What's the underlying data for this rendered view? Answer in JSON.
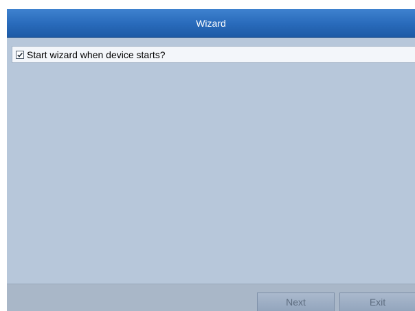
{
  "window": {
    "title": "Wizard"
  },
  "options": {
    "start_wizard": {
      "label": "Start wizard when device starts?",
      "checked": true
    }
  },
  "footer": {
    "next_label": "Next",
    "exit_label": "Exit"
  },
  "colors": {
    "title_bar": "#2a6cbc",
    "body_background": "#b7c7da",
    "footer_background": "#a9b7c8"
  },
  "icons": {
    "checkbox": "checkmark-icon"
  }
}
